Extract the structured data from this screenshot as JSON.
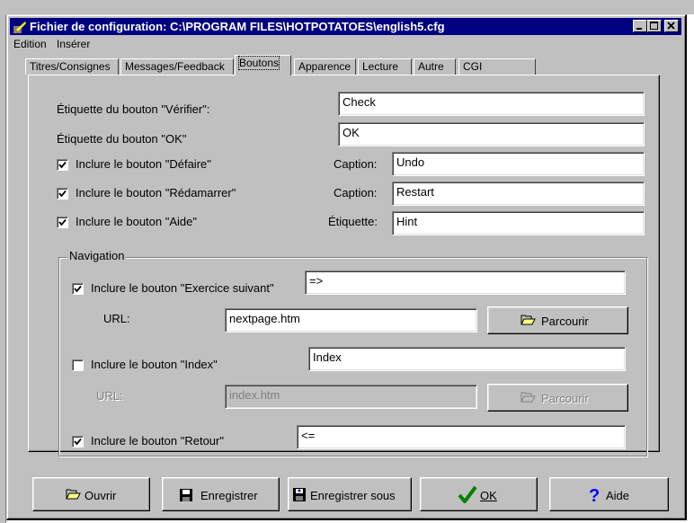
{
  "window": {
    "title": "Fichier de configuration: C:\\PROGRAM FILES\\HOTPOTATOES\\english5.cfg"
  },
  "menu": [
    "Edition",
    "Insérer"
  ],
  "tabs": [
    "Titres/Consignes",
    "Messages/Feedback",
    "Boutons",
    "Apparence",
    "Lecture",
    "Autre",
    "CGI"
  ],
  "active_tab": "Boutons",
  "buttons_section": {
    "check_label": "Étiquette du bouton \"Vérifier\":",
    "check_value": "Check",
    "ok_label": "Étiquette du bouton \"OK\"",
    "ok_value": "OK",
    "undo": {
      "label": "Inclure le bouton  \"Défaire\"",
      "checked": true,
      "caption_label": "Caption:",
      "caption_value": "Undo"
    },
    "restart": {
      "label": "Inclure le bouton \"Rédamarrer\"",
      "checked": true,
      "caption_label": "Caption:",
      "caption_value": "Restart"
    },
    "hint": {
      "label": "Inclure le bouton \"Aide\"",
      "checked": true,
      "caption_label": "Étiquette:",
      "caption_value": "Hint"
    }
  },
  "navigation": {
    "title": "Navigation",
    "next": {
      "label": "Inclure le bouton \"Exercice suivant\"",
      "checked": true,
      "value": "=>",
      "url_label": "URL:",
      "url_value": "nextpage.htm",
      "browse": "Parcourir"
    },
    "index": {
      "label": "Inclure le bouton \"Index\"",
      "checked": false,
      "value": "Index",
      "url_label": "URL:",
      "url_value": "index.htm",
      "browse": "Parcourir"
    },
    "back": {
      "label": "Inclure le bouton \"Retour\"",
      "checked": true,
      "value": "<="
    }
  },
  "bottom_buttons": {
    "open": "Ouvrir",
    "save": "Enregistrer",
    "save_as": "Enregistrer sous",
    "ok": "OK",
    "help": "Aide"
  },
  "colors": {
    "titlebar": "#000080",
    "face": "#c0c0c0",
    "check_green": "#008000",
    "help_blue": "#0000ff"
  }
}
